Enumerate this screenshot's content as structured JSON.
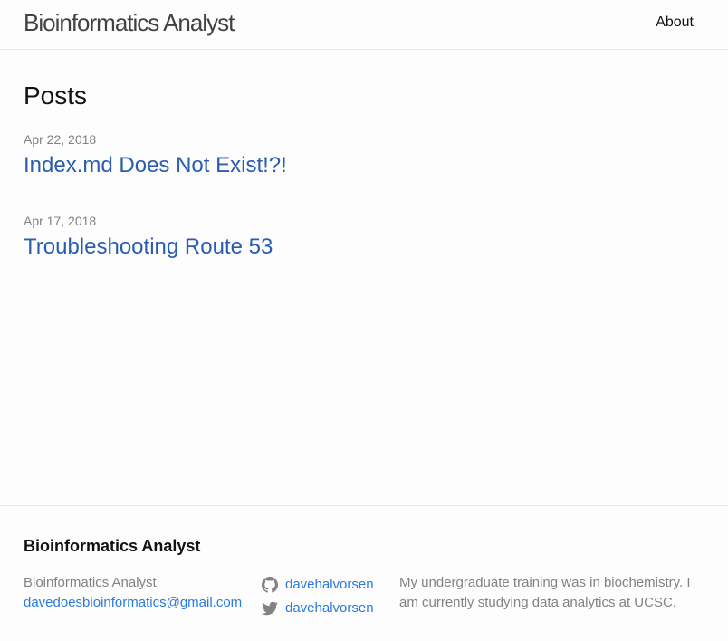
{
  "header": {
    "site_title": "Bioinformatics Analyst",
    "nav": {
      "about": "About"
    }
  },
  "main": {
    "heading": "Posts",
    "posts": [
      {
        "date": "Apr 22, 2018",
        "title": "Index.md Does Not Exist!?!"
      },
      {
        "date": "Apr 17, 2018",
        "title": "Troubleshooting Route 53"
      }
    ]
  },
  "footer": {
    "heading": "Bioinformatics Analyst",
    "name": "Bioinformatics Analyst",
    "email": "davedoesbioinformatics@gmail.com",
    "github": {
      "icon": "github-icon",
      "username": "davehalvorsen"
    },
    "twitter": {
      "icon": "twitter-icon",
      "username": "davehalvorsen"
    },
    "description": "My undergraduate training was in biochemistry. I am currently studying data analytics at UCSC."
  },
  "colors": {
    "link": "#2a5db0",
    "footer_link": "#2a7ae2",
    "meta_grey": "#828282",
    "border": "#e8e8e8",
    "background": "#fdfdfd"
  }
}
